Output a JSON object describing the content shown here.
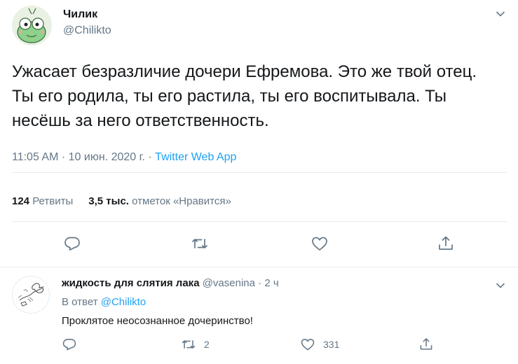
{
  "tweet": {
    "author_name": "Чилик",
    "author_handle": "@Chilikto",
    "text": "Ужасает безразличие дочери Ефремова. Это же твой отец. Ты его родила, ты его растила, ты его воспитывала. Ты несёшь за него ответственность.",
    "time": "11:05 AM",
    "date": "10 июн. 2020 г.",
    "separator": "·",
    "source": "Twitter Web App",
    "retweets_count": "124",
    "retweets_label": "Ретвиты",
    "likes_count": "3,5 тыс.",
    "likes_label": "отметок «Нравится»",
    "icons": {
      "avatar": "frog-character-avatar",
      "menu": "chevron-down-icon",
      "reply": "reply-icon",
      "retweet": "retweet-icon",
      "like": "heart-icon",
      "share": "share-icon"
    }
  },
  "reply": {
    "author_name": "жидкость для слятия лака",
    "author_handle": "@vasenina",
    "separator": "·",
    "time": "2 ч",
    "reply_prefix": "В ответ",
    "reply_to": "@Chilikto",
    "text": "Проклятое неосознанное дочеринство!",
    "retweets_count": "2",
    "likes_count": "331",
    "icons": {
      "avatar": "sketch-drawing-avatar",
      "menu": "chevron-down-icon",
      "reply": "reply-icon",
      "retweet": "retweet-icon",
      "like": "heart-icon",
      "share": "share-icon"
    }
  },
  "colors": {
    "text": "#14171a",
    "secondary": "#657786",
    "link": "#1da1f2",
    "divider": "#e6ecf0"
  }
}
